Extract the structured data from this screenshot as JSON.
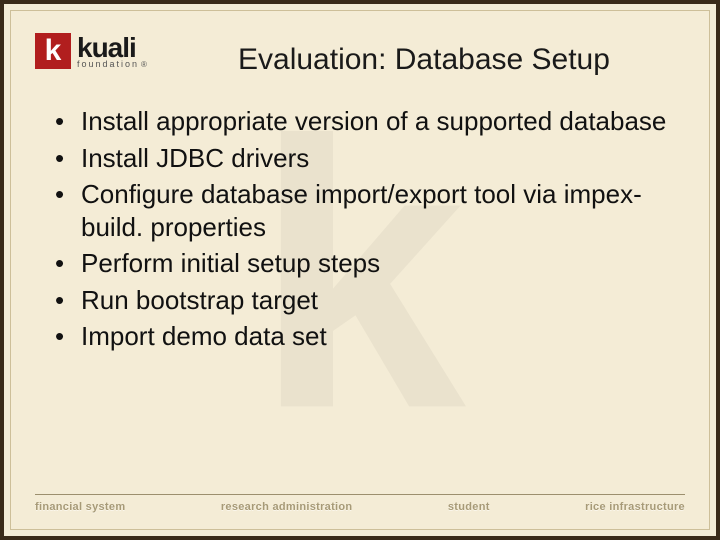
{
  "logo": {
    "brand": "kuali",
    "sub": "foundation"
  },
  "title": "Evaluation: Database Setup",
  "bullets": [
    "Install appropriate version of a supported database",
    "Install JDBC drivers",
    "Configure database import/export tool via impex-build. properties",
    "Perform initial setup steps",
    "Run bootstrap target",
    "Import demo data set"
  ],
  "footer": [
    "financial system",
    "research administration",
    "student",
    "rice infrastructure"
  ]
}
